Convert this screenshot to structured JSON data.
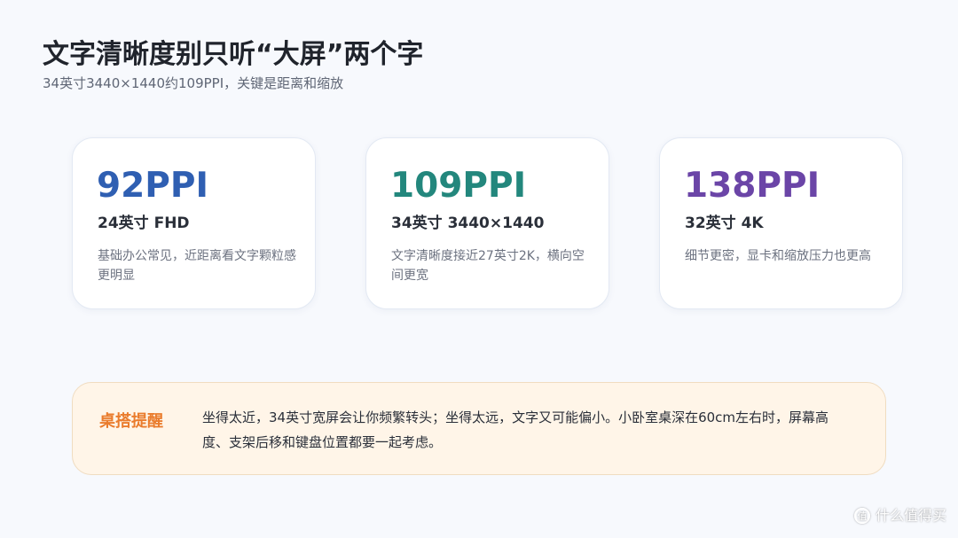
{
  "header": {
    "title": "文字清晰度别只听“大屏”两个字",
    "subtitle": "34英寸3440×1440约109PPI，关键是距离和缩放"
  },
  "cards": [
    {
      "value": "92PPI",
      "label": "24英寸 FHD",
      "description": "基础办公常见，近距离看文字颗粒感更明显",
      "color": "#2f5fb2"
    },
    {
      "value": "109PPI",
      "label": "34英寸 3440×1440",
      "description": "文字清晰度接近27英寸2K，横向空间更宽",
      "color": "#23877d"
    },
    {
      "value": "138PPI",
      "label": "32英寸 4K",
      "description": "细节更密，显卡和缩放压力也更高",
      "color": "#6b45a7"
    }
  ],
  "tip": {
    "title": "桌搭提醒",
    "text": "坐得太近，34英寸宽屏会让你频繁转头；坐得太远，文字又可能偏小。小卧室桌深在60cm左右时，屏幕高度、支架后移和键盘位置都要一起考虑。"
  },
  "watermark": {
    "icon": "zhi-logo-icon",
    "text": "什么值得买",
    "icon_text": "值"
  }
}
